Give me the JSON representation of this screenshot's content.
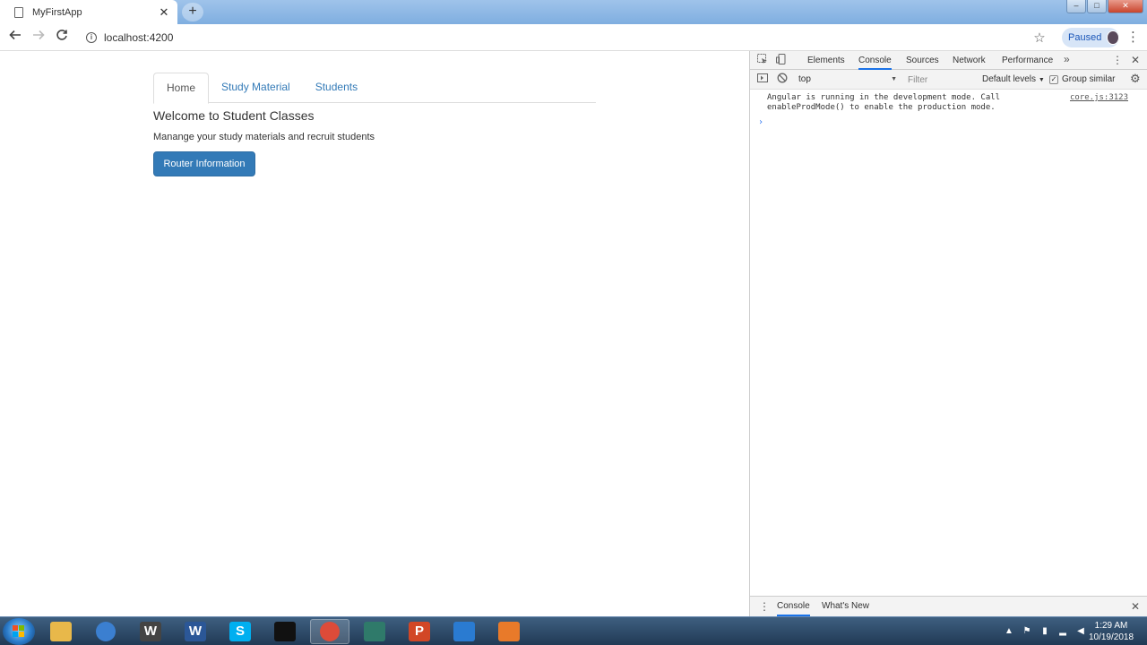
{
  "browser": {
    "tab_title": "MyFirstApp",
    "url": "localhost:4200",
    "profile_label": "Paused",
    "accent": "#337ab7"
  },
  "page": {
    "nav_tabs": [
      {
        "label": "Home",
        "active": true
      },
      {
        "label": "Study Material",
        "active": false
      },
      {
        "label": "Students",
        "active": false
      }
    ],
    "heading": "Welcome to Student Classes",
    "description": "Manange your study materials and recruit students",
    "primary_button": "Router Information"
  },
  "devtools": {
    "tabs": [
      {
        "label": "Elements"
      },
      {
        "label": "Console",
        "active": true
      },
      {
        "label": "Sources"
      },
      {
        "label": "Network"
      },
      {
        "label": "Performance"
      }
    ],
    "context": "top",
    "filter_placeholder": "Filter",
    "levels": "Default levels",
    "group_similar": "Group similar",
    "console_message": {
      "line1": "Angular is running in the development mode. Call",
      "line2": "enableProdMode() to enable the production mode.",
      "source": "core.js:3123"
    },
    "drawer_tabs": [
      {
        "label": "Console",
        "active": true
      },
      {
        "label": "What's New"
      }
    ]
  },
  "taskbar": {
    "time": "1:29 AM",
    "date": "10/19/2018",
    "apps": [
      {
        "name": "file-explorer-icon",
        "glyph": "",
        "color": "#e8b84a"
      },
      {
        "name": "chrome-icon",
        "glyph": "",
        "color": "#3b7fd0"
      },
      {
        "name": "writer-icon",
        "glyph": "W",
        "color": "#444444"
      },
      {
        "name": "word-icon",
        "glyph": "W",
        "color": "#2b5797"
      },
      {
        "name": "skype-icon",
        "glyph": "S",
        "color": "#00aff0"
      },
      {
        "name": "terminal-icon",
        "glyph": "",
        "color": "#111111"
      },
      {
        "name": "chrome-icon",
        "glyph": "",
        "color": "#dd4b39"
      },
      {
        "name": "window-icon",
        "glyph": "",
        "color": "#2f7a6a"
      },
      {
        "name": "powerpoint-icon",
        "glyph": "P",
        "color": "#d24726"
      },
      {
        "name": "vscode-icon",
        "glyph": "",
        "color": "#2a7bd1"
      },
      {
        "name": "recorder-icon",
        "glyph": "",
        "color": "#e87a2a"
      }
    ]
  }
}
